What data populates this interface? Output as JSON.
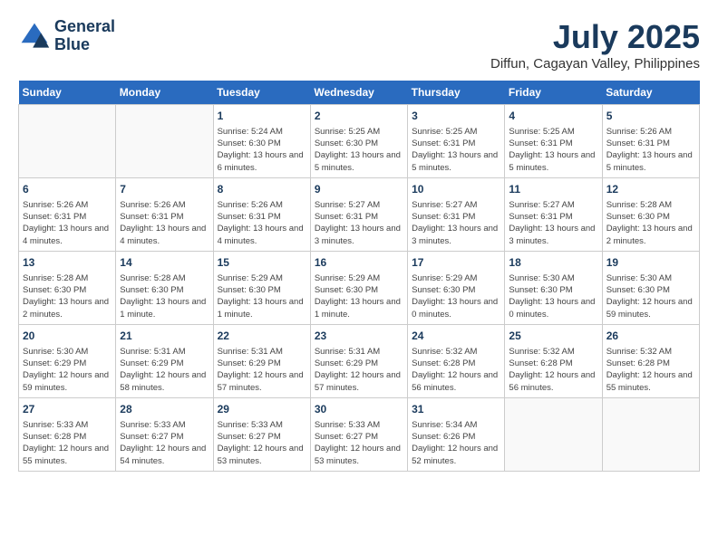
{
  "header": {
    "logo_line1": "General",
    "logo_line2": "Blue",
    "month": "July 2025",
    "location": "Diffun, Cagayan Valley, Philippines"
  },
  "weekdays": [
    "Sunday",
    "Monday",
    "Tuesday",
    "Wednesday",
    "Thursday",
    "Friday",
    "Saturday"
  ],
  "weeks": [
    [
      {
        "day": "",
        "info": ""
      },
      {
        "day": "",
        "info": ""
      },
      {
        "day": "1",
        "sunrise": "Sunrise: 5:24 AM",
        "sunset": "Sunset: 6:30 PM",
        "daylight": "Daylight: 13 hours and 6 minutes."
      },
      {
        "day": "2",
        "sunrise": "Sunrise: 5:25 AM",
        "sunset": "Sunset: 6:30 PM",
        "daylight": "Daylight: 13 hours and 5 minutes."
      },
      {
        "day": "3",
        "sunrise": "Sunrise: 5:25 AM",
        "sunset": "Sunset: 6:31 PM",
        "daylight": "Daylight: 13 hours and 5 minutes."
      },
      {
        "day": "4",
        "sunrise": "Sunrise: 5:25 AM",
        "sunset": "Sunset: 6:31 PM",
        "daylight": "Daylight: 13 hours and 5 minutes."
      },
      {
        "day": "5",
        "sunrise": "Sunrise: 5:26 AM",
        "sunset": "Sunset: 6:31 PM",
        "daylight": "Daylight: 13 hours and 5 minutes."
      }
    ],
    [
      {
        "day": "6",
        "sunrise": "Sunrise: 5:26 AM",
        "sunset": "Sunset: 6:31 PM",
        "daylight": "Daylight: 13 hours and 4 minutes."
      },
      {
        "day": "7",
        "sunrise": "Sunrise: 5:26 AM",
        "sunset": "Sunset: 6:31 PM",
        "daylight": "Daylight: 13 hours and 4 minutes."
      },
      {
        "day": "8",
        "sunrise": "Sunrise: 5:26 AM",
        "sunset": "Sunset: 6:31 PM",
        "daylight": "Daylight: 13 hours and 4 minutes."
      },
      {
        "day": "9",
        "sunrise": "Sunrise: 5:27 AM",
        "sunset": "Sunset: 6:31 PM",
        "daylight": "Daylight: 13 hours and 3 minutes."
      },
      {
        "day": "10",
        "sunrise": "Sunrise: 5:27 AM",
        "sunset": "Sunset: 6:31 PM",
        "daylight": "Daylight: 13 hours and 3 minutes."
      },
      {
        "day": "11",
        "sunrise": "Sunrise: 5:27 AM",
        "sunset": "Sunset: 6:31 PM",
        "daylight": "Daylight: 13 hours and 3 minutes."
      },
      {
        "day": "12",
        "sunrise": "Sunrise: 5:28 AM",
        "sunset": "Sunset: 6:30 PM",
        "daylight": "Daylight: 13 hours and 2 minutes."
      }
    ],
    [
      {
        "day": "13",
        "sunrise": "Sunrise: 5:28 AM",
        "sunset": "Sunset: 6:30 PM",
        "daylight": "Daylight: 13 hours and 2 minutes."
      },
      {
        "day": "14",
        "sunrise": "Sunrise: 5:28 AM",
        "sunset": "Sunset: 6:30 PM",
        "daylight": "Daylight: 13 hours and 1 minute."
      },
      {
        "day": "15",
        "sunrise": "Sunrise: 5:29 AM",
        "sunset": "Sunset: 6:30 PM",
        "daylight": "Daylight: 13 hours and 1 minute."
      },
      {
        "day": "16",
        "sunrise": "Sunrise: 5:29 AM",
        "sunset": "Sunset: 6:30 PM",
        "daylight": "Daylight: 13 hours and 1 minute."
      },
      {
        "day": "17",
        "sunrise": "Sunrise: 5:29 AM",
        "sunset": "Sunset: 6:30 PM",
        "daylight": "Daylight: 13 hours and 0 minutes."
      },
      {
        "day": "18",
        "sunrise": "Sunrise: 5:30 AM",
        "sunset": "Sunset: 6:30 PM",
        "daylight": "Daylight: 13 hours and 0 minutes."
      },
      {
        "day": "19",
        "sunrise": "Sunrise: 5:30 AM",
        "sunset": "Sunset: 6:30 PM",
        "daylight": "Daylight: 12 hours and 59 minutes."
      }
    ],
    [
      {
        "day": "20",
        "sunrise": "Sunrise: 5:30 AM",
        "sunset": "Sunset: 6:29 PM",
        "daylight": "Daylight: 12 hours and 59 minutes."
      },
      {
        "day": "21",
        "sunrise": "Sunrise: 5:31 AM",
        "sunset": "Sunset: 6:29 PM",
        "daylight": "Daylight: 12 hours and 58 minutes."
      },
      {
        "day": "22",
        "sunrise": "Sunrise: 5:31 AM",
        "sunset": "Sunset: 6:29 PM",
        "daylight": "Daylight: 12 hours and 57 minutes."
      },
      {
        "day": "23",
        "sunrise": "Sunrise: 5:31 AM",
        "sunset": "Sunset: 6:29 PM",
        "daylight": "Daylight: 12 hours and 57 minutes."
      },
      {
        "day": "24",
        "sunrise": "Sunrise: 5:32 AM",
        "sunset": "Sunset: 6:28 PM",
        "daylight": "Daylight: 12 hours and 56 minutes."
      },
      {
        "day": "25",
        "sunrise": "Sunrise: 5:32 AM",
        "sunset": "Sunset: 6:28 PM",
        "daylight": "Daylight: 12 hours and 56 minutes."
      },
      {
        "day": "26",
        "sunrise": "Sunrise: 5:32 AM",
        "sunset": "Sunset: 6:28 PM",
        "daylight": "Daylight: 12 hours and 55 minutes."
      }
    ],
    [
      {
        "day": "27",
        "sunrise": "Sunrise: 5:33 AM",
        "sunset": "Sunset: 6:28 PM",
        "daylight": "Daylight: 12 hours and 55 minutes."
      },
      {
        "day": "28",
        "sunrise": "Sunrise: 5:33 AM",
        "sunset": "Sunset: 6:27 PM",
        "daylight": "Daylight: 12 hours and 54 minutes."
      },
      {
        "day": "29",
        "sunrise": "Sunrise: 5:33 AM",
        "sunset": "Sunset: 6:27 PM",
        "daylight": "Daylight: 12 hours and 53 minutes."
      },
      {
        "day": "30",
        "sunrise": "Sunrise: 5:33 AM",
        "sunset": "Sunset: 6:27 PM",
        "daylight": "Daylight: 12 hours and 53 minutes."
      },
      {
        "day": "31",
        "sunrise": "Sunrise: 5:34 AM",
        "sunset": "Sunset: 6:26 PM",
        "daylight": "Daylight: 12 hours and 52 minutes."
      },
      {
        "day": "",
        "info": ""
      },
      {
        "day": "",
        "info": ""
      }
    ]
  ]
}
